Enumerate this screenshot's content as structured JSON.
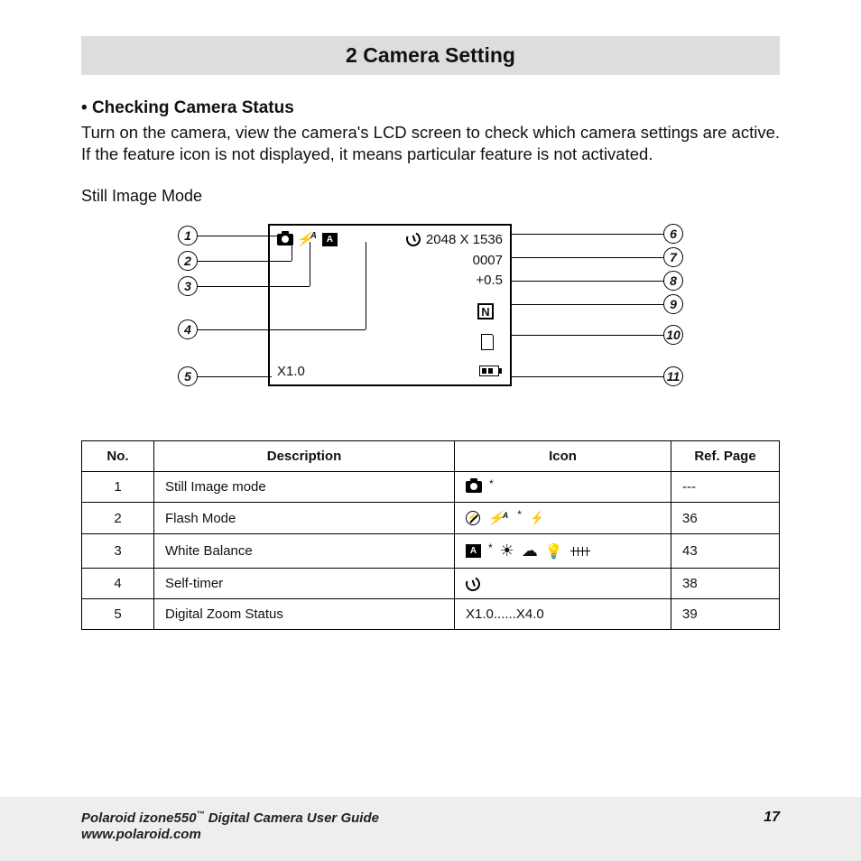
{
  "chapter_title": "2 Camera Setting",
  "section": {
    "bullet": "•",
    "title": "Checking Camera Status",
    "body": "Turn on the camera, view the camera's LCD screen to check which camera settings are active. If the feature icon is not displayed, it means particular feature is not activated."
  },
  "mode_label": "Still Image Mode",
  "lcd": {
    "resolution": "2048 X 1536",
    "count": "0007",
    "ev": "+0.5",
    "quality": "N",
    "zoom": "X1.0"
  },
  "callouts_left": [
    "1",
    "2",
    "3",
    "4",
    "5"
  ],
  "callouts_right": [
    "6",
    "7",
    "8",
    "9",
    "10",
    "11"
  ],
  "table": {
    "headers": {
      "no": "No.",
      "desc": "Description",
      "icon": "Icon",
      "ref": "Ref. Page"
    },
    "rows": [
      {
        "no": "1",
        "desc": "Still Image mode",
        "icon_key": "camera",
        "ref": "---"
      },
      {
        "no": "2",
        "desc": "Flash Mode",
        "icon_key": "flash_modes",
        "ref": "36"
      },
      {
        "no": "3",
        "desc": "White Balance",
        "icon_key": "wb_modes",
        "ref": "43"
      },
      {
        "no": "4",
        "desc": "Self-timer",
        "icon_key": "timer",
        "ref": "38"
      },
      {
        "no": "5",
        "desc": "Digital Zoom Status",
        "icon_key": "zoom_range",
        "ref": "39"
      }
    ],
    "zoom_range_text": "X1.0......X4.0"
  },
  "footer": {
    "guide_prefix": "Polaroid izone550",
    "tm": "™",
    "guide_suffix": " Digital Camera User Guide",
    "url": "www.polaroid.com",
    "page": "17"
  }
}
